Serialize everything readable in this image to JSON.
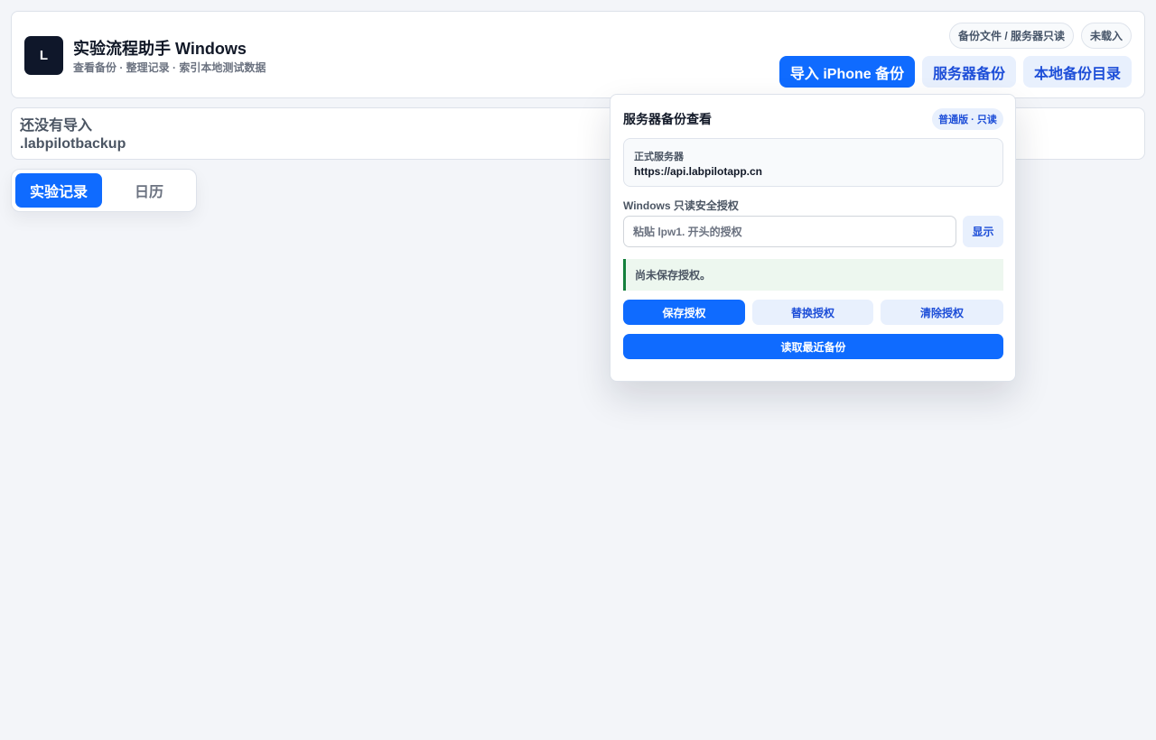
{
  "header": {
    "logo_letter": "L",
    "title": "实验流程助手 Windows",
    "subtitle": "查看备份 · 整理记录 · 索引本地测试数据",
    "source_pill": "备份文件 / 服务器只读",
    "status_pill": "未载入",
    "import_button": "导入 iPhone 备份",
    "server_button": "服务器备份",
    "local_button": "本地备份目录"
  },
  "banner": {
    "message": "还没有导入 .labpilotbackup"
  },
  "tabs": [
    {
      "label": "实验记录",
      "active": true
    },
    {
      "label": "日历",
      "active": false
    }
  ],
  "server_panel": {
    "title": "服务器备份查看",
    "edition_badge": "普通版 · 只读",
    "server_label": "正式服务器",
    "server_url": "https://api.labpilotapp.cn",
    "token_label": "Windows 只读安全授权",
    "token_value": "",
    "token_placeholder": "粘贴 lpw1. 开头的授权",
    "show_button": "显示",
    "notice": "尚未保存授权。",
    "save_button": "保存授权",
    "replace_button": "替换授权",
    "clear_button": "清除授权",
    "read_button": "读取最近备份"
  },
  "colors": {
    "accent": "#0f6bff",
    "accent_soft": "#e8f0fd",
    "notice_border": "#15803d",
    "logo_bg": "#0f172a"
  }
}
